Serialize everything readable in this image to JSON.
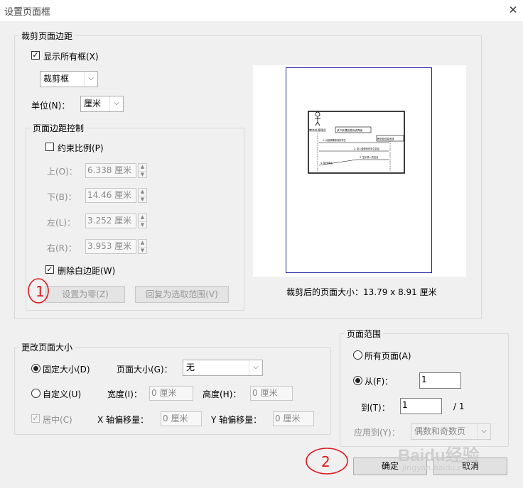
{
  "window": {
    "title": "设置页面框",
    "close_glyph": "✕"
  },
  "crop_margins": {
    "legend": "裁剪页面边距",
    "show_all_boxes": {
      "label": "显示所有框(X)",
      "checked": true
    },
    "box_type": "裁剪框",
    "unit_label": "单位(N)：",
    "unit_value": "厘米",
    "margin_controls": {
      "legend": "页面边距控制",
      "constrain": {
        "label": "约束比例(P)",
        "checked": false
      },
      "fields": [
        {
          "label": "上(O)：",
          "value": "6.338 厘米"
        },
        {
          "label": "下(B)：",
          "value": "14.46 厘米"
        },
        {
          "label": "左(L)：",
          "value": "3.252 厘米"
        },
        {
          "label": "右(R)：",
          "value": "3.953 厘米"
        }
      ],
      "remove_white_margins": {
        "label": "删除白边距(W)",
        "checked": true
      },
      "set_to_zero": "设置为零(Z)",
      "revert_to_selection": "回复为选取范围(V)"
    },
    "preview": {
      "cropped_size": "裁剪后的页面大小：13.79 x 8.91 厘米",
      "actor_label": "教务处管理员",
      "frame_title": "该户校理信息系统界面",
      "lifeline_title": "教务处信息系统",
      "messages": [
        "1. 请选择要修改的学生",
        "2. 录入要修改的学生信息",
        "3. 显示录入的信息",
        "4. 操作成功"
      ]
    }
  },
  "page_size_change": {
    "legend": "更改页面大小",
    "fixed_size": {
      "label": "固定大小(D)",
      "selected": true
    },
    "page_size_label": "页面大小(G)：",
    "page_size_value": "无",
    "custom": {
      "label": "自定义(U)",
      "selected": false
    },
    "width_label": "宽度(I)：",
    "width_value": "0 厘米",
    "height_label": "高度(H)：",
    "height_value": "0 厘米",
    "center": {
      "label": "居中(C)",
      "checked": true
    },
    "x_offset_label": "X 轴偏移量：",
    "x_offset_value": "0 厘米",
    "y_offset_label": "Y 轴偏移量：",
    "y_offset_value": "0 厘米"
  },
  "page_range": {
    "legend": "页面范围",
    "all_pages": {
      "label": "所有页面(A)",
      "selected": false
    },
    "from": {
      "label": "从(F)：",
      "selected": true,
      "value": "1"
    },
    "to_label": "到(T)：",
    "to_value": "1",
    "total": "/ 1",
    "apply_to_label": "应用到(Y)：",
    "apply_to_value": "偶数和奇数页"
  },
  "footer": {
    "ok": "确定",
    "cancel": "取消"
  },
  "annotations": {
    "mark1": "1",
    "mark2": "2"
  },
  "watermark": {
    "brand": "Baidu经验",
    "url": "jingyan.baidu.com"
  }
}
